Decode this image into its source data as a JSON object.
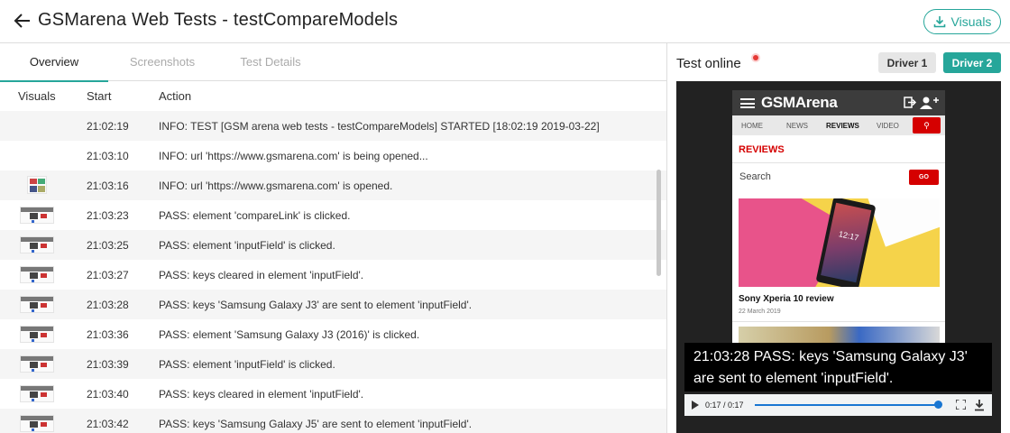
{
  "header": {
    "title": "GSMarena Web Tests - testCompareModels",
    "visuals_label": "Visuals"
  },
  "tabs": [
    {
      "label": "Overview",
      "active": true
    },
    {
      "label": "Screenshots",
      "active": false
    },
    {
      "label": "Test Details",
      "active": false
    }
  ],
  "columns": {
    "visuals": "Visuals",
    "start": "Start",
    "action": "Action"
  },
  "rows": [
    {
      "visual": "none",
      "start": "21:02:19",
      "action": "INFO: TEST [GSM arena web tests - testCompareModels] STARTED [18:02:19 2019-03-22]"
    },
    {
      "visual": "none",
      "start": "21:03:10",
      "action": "INFO: url 'https://www.gsmarena.com' is being opened..."
    },
    {
      "visual": "grid",
      "start": "21:03:16",
      "action": "INFO: url 'https://www.gsmarena.com' is opened."
    },
    {
      "visual": "page",
      "start": "21:03:23",
      "action": "PASS: element 'compareLink' is clicked."
    },
    {
      "visual": "page",
      "start": "21:03:25",
      "action": "PASS: element 'inputField' is clicked."
    },
    {
      "visual": "page",
      "start": "21:03:27",
      "action": "PASS: keys cleared in element 'inputField'."
    },
    {
      "visual": "page",
      "start": "21:03:28",
      "action": "PASS: keys 'Samsung Galaxy J3' are sent to element 'inputField'."
    },
    {
      "visual": "page",
      "start": "21:03:36",
      "action": "PASS: element 'Samsung Galaxy J3 (2016)' is clicked."
    },
    {
      "visual": "page",
      "start": "21:03:39",
      "action": "PASS: element 'inputField' is clicked."
    },
    {
      "visual": "page",
      "start": "21:03:40",
      "action": "PASS: keys cleared in element 'inputField'."
    },
    {
      "visual": "page",
      "start": "21:03:42",
      "action": "PASS: keys 'Samsung Galaxy J5' are sent to element 'inputField'."
    }
  ],
  "right_panel": {
    "title": "Test online",
    "drivers": [
      {
        "label": "Driver 1",
        "active": false
      },
      {
        "label": "Driver 2",
        "active": true
      }
    ]
  },
  "preview": {
    "logo": "GSMArena",
    "nav": [
      "HOME",
      "NEWS",
      "REVIEWS",
      "VIDEO"
    ],
    "section": "REVIEWS",
    "search_placeholder": "Search",
    "go_label": "GO",
    "clock": "12:17",
    "review_title": "Sony Xperia 10 review",
    "review_date": "22 March 2019"
  },
  "video": {
    "subtitle": "21:03:28 PASS: keys 'Samsung Galaxy J3' are sent to element 'inputField'.",
    "time": "0:17 / 0:17",
    "progress": 1.0
  },
  "colors": {
    "accent": "#26a69a",
    "brand_red": "#d50000",
    "progress_blue": "#1976d2"
  }
}
